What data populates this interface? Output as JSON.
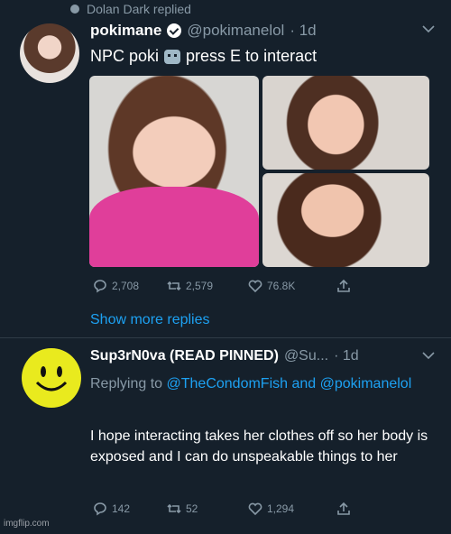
{
  "context": {
    "text": "Dolan Dark replied"
  },
  "tweet1": {
    "author_name": "pokimane",
    "author_handle": "@pokimanelol",
    "time": "· 1d",
    "text_before": "NPC poki",
    "text_after": "press E to interact",
    "actions": {
      "replies": "2,708",
      "retweets": "2,579",
      "likes": "76.8K"
    }
  },
  "show_more": "Show more replies",
  "tweet2": {
    "author_name": "Sup3rN0va (READ PINNED)",
    "author_handle": "@Su...",
    "time": "· 1d",
    "replying_prefix": "Replying to",
    "replying_handle1": "@TheCondomFish",
    "replying_and": "and",
    "replying_handle2": "@pokimanelol",
    "text": "I hope interacting takes her clothes off so her body is exposed and I can do unspeakable things to her",
    "actions": {
      "replies": "142",
      "retweets": "52",
      "likes": "1,294"
    }
  },
  "watermark": "imgflip.com",
  "colors": {
    "background": "#15202b",
    "muted": "#8899a6",
    "link": "#1da1f2",
    "text": "#ffffff"
  }
}
